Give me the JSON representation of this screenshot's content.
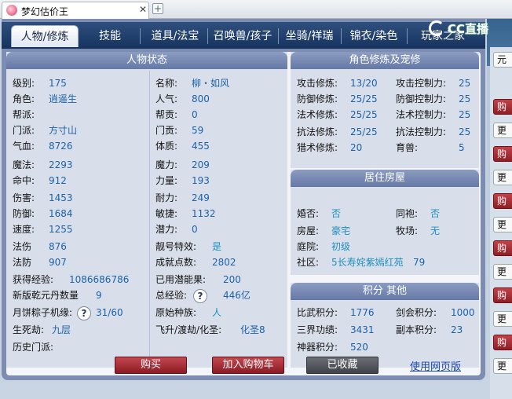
{
  "browser": {
    "tab_title": "梦幻估价王",
    "close_glyph": "✕",
    "newtab_glyph": "+",
    "logo_text": "CC直播"
  },
  "tabs": [
    {
      "label": "人物/修炼",
      "active": true
    },
    {
      "label": "技能",
      "active": false
    },
    {
      "label": "道具/法宝",
      "active": false
    },
    {
      "label": "召唤兽/孩子",
      "active": false
    },
    {
      "label": "坐骑/祥瑞",
      "active": false
    },
    {
      "label": "锦衣/染色",
      "active": false
    },
    {
      "label": "玩家之家",
      "active": false
    }
  ],
  "character": {
    "title": "人物状态",
    "left": [
      {
        "label": "级别:",
        "value": "175"
      },
      {
        "label": "角色:",
        "value": "逍遥生"
      },
      {
        "label": "帮派:",
        "value": ""
      },
      {
        "label": "门派:",
        "value": "方寸山"
      },
      {
        "label": "气血:",
        "value": "8726"
      },
      {
        "label": "魔法:",
        "value": "2293"
      },
      {
        "label": "命中:",
        "value": "912"
      },
      {
        "label": "伤害:",
        "value": "1453"
      },
      {
        "label": "防御:",
        "value": "1684"
      },
      {
        "label": "速度:",
        "value": "1255"
      },
      {
        "label": "法伤",
        "value": "876"
      },
      {
        "label": "法防",
        "value": "907"
      },
      {
        "label": "获得经验:",
        "value": "1086686786"
      },
      {
        "label": "新版乾元丹数量",
        "value": "9"
      },
      {
        "label": "月饼粽子机缘:",
        "value": "31/60"
      },
      {
        "label": "生死劫:",
        "value": "九层"
      },
      {
        "label": "历史门派:",
        "value": ""
      }
    ],
    "right": [
      {
        "label": "名称:",
        "value": "柳・如风"
      },
      {
        "label": "人气:",
        "value": "800"
      },
      {
        "label": "帮贡:",
        "value": "0"
      },
      {
        "label": "门贡:",
        "value": "59"
      },
      {
        "label": "体质:",
        "value": "455"
      },
      {
        "label": "魔力:",
        "value": "209"
      },
      {
        "label": "力量:",
        "value": "193"
      },
      {
        "label": "耐力:",
        "value": "249"
      },
      {
        "label": "敏捷:",
        "value": "1132"
      },
      {
        "label": "潜力:",
        "value": "0"
      },
      {
        "label": "靓号特效:",
        "value": "是"
      },
      {
        "label": "成就点数:",
        "value": "2802"
      },
      {
        "label": "已用潜能果:",
        "value": "200"
      },
      {
        "label": "总经验:",
        "value": "446亿"
      },
      {
        "label": "原始种族:",
        "value": "人"
      },
      {
        "label": "飞升/渡劫/化圣:",
        "value": "化圣8"
      }
    ],
    "help_glyph": "?"
  },
  "cultivation": {
    "title": "角色修炼及宠修",
    "rows": [
      {
        "l1": "攻击修炼:",
        "v1": "13/20",
        "l2": "攻击控制力:",
        "v2": "25"
      },
      {
        "l1": "防御修炼:",
        "v1": "25/25",
        "l2": "防御控制力:",
        "v2": "25"
      },
      {
        "l1": "法术修炼:",
        "v1": "25/25",
        "l2": "法术控制力:",
        "v2": "25"
      },
      {
        "l1": "抗法修炼:",
        "v1": "25/25",
        "l2": "抗法控制力:",
        "v2": "25"
      },
      {
        "l1": "猎术修炼:",
        "v1": "20",
        "l2": "育兽:",
        "v2": "5"
      }
    ]
  },
  "housing": {
    "title": "居住房屋",
    "marriage_label": "婚否:",
    "marriage_value": "否",
    "sworn_label": "同袍:",
    "sworn_value": "否",
    "house_label": "房屋:",
    "house_value": "豪宅",
    "ranch_label": "牧场:",
    "ranch_value": "无",
    "yard_label": "庭院:",
    "yard_value": "初级",
    "community_label": "社区:",
    "community_value": "5长寿姹紫嫣红苑",
    "community_num": "79"
  },
  "scores": {
    "title": "积分 其他",
    "rows": [
      {
        "l1": "比武积分:",
        "v1": "1776",
        "l2": "剑会积分:",
        "v2": "1000"
      },
      {
        "l1": "三界功绩:",
        "v1": "3431",
        "l2": "副本积分:",
        "v2": "23"
      },
      {
        "l1": "神器积分:",
        "v1": "520",
        "l2": "",
        "v2": ""
      }
    ]
  },
  "actions": {
    "buy": "购买",
    "add_cart": "加入购物车",
    "favorited": "已收藏",
    "web_version": "使用网页版"
  },
  "side": {
    "btn_red": "购",
    "btn_white": "更",
    "btn_top": "元"
  },
  "colors": {
    "value": "#1b62a8",
    "header": "#6579a6",
    "buy_red": "#8a1b24"
  }
}
